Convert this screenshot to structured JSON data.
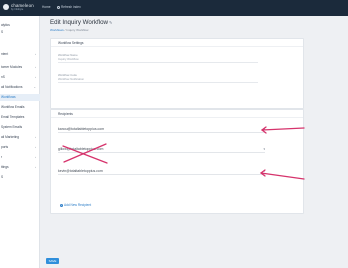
{
  "topbar": {
    "logo_name": "chameleon",
    "logo_sub": "by Infobyte",
    "nav_home": "Home",
    "nav_refresh": "Refresh index"
  },
  "sidebar": {
    "items": [
      {
        "label": "alytics",
        "chevron": ""
      },
      {
        "label": "S",
        "chevron": ""
      },
      {
        "label": "ntent",
        "chevron": "›"
      },
      {
        "label": "tomer Modules",
        "chevron": "›"
      },
      {
        "label": "nS",
        "chevron": "›"
      },
      {
        "label": "ail Notifications",
        "chevron": "⌄"
      },
      {
        "label": "Workflows",
        "chevron": "",
        "active": true
      },
      {
        "label": "Workflow Emails",
        "chevron": ""
      },
      {
        "label": "Email Templates",
        "chevron": ""
      },
      {
        "label": "System Emails",
        "chevron": ""
      },
      {
        "label": "ail Marketing",
        "chevron": "›"
      },
      {
        "label": "ports",
        "chevron": "›"
      },
      {
        "label": "r",
        "chevron": "›"
      },
      {
        "label": "ttings",
        "chevron": "›"
      },
      {
        "label": "S",
        "chevron": ""
      }
    ]
  },
  "page": {
    "title": "Edit Inquiry Workflow",
    "breadcrumb_link": "Workflows",
    "breadcrumb_sep": "/",
    "breadcrumb_current": "Inquiry Workflow"
  },
  "settings_card": {
    "header": "Workflow Settings",
    "name_label": "Workflow Name",
    "name_value": "Inquiry Workflow",
    "code_label": "Workflow Code",
    "code_value": "Workflow Notification"
  },
  "recipients_card": {
    "header": "Recipients",
    "recipients": [
      {
        "email": "kanou@totaltabletoppius.com"
      },
      {
        "email": "gillow@totaltabletoppius.com"
      },
      {
        "email": "kevin@totaltabletoppius.com"
      }
    ],
    "add_label": "Add New Recipient"
  },
  "footer": {
    "save_label": "SAVE"
  },
  "colors": {
    "annotation": "#d6336c",
    "accent": "#2a7cc7",
    "topbar": "#1b2a3b"
  }
}
